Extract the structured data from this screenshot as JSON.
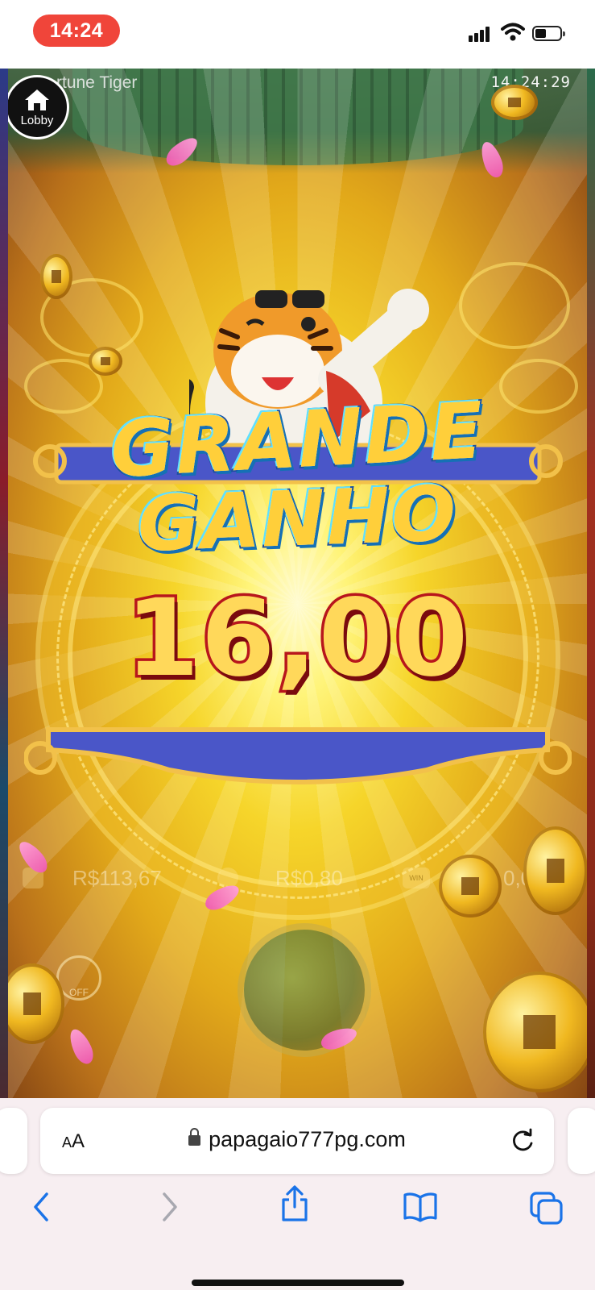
{
  "status_bar": {
    "time": "14:24",
    "signal_icon": "cellular-signal-icon",
    "wifi_icon": "wifi-icon",
    "battery_icon": "battery-icon",
    "battery_level": 0.35
  },
  "game": {
    "title": "rtune Tiger",
    "clock": "14:24:29",
    "lobby_label": "Lobby",
    "lobby_icon": "home-icon",
    "win_title_line1": "GRANDE",
    "win_title_line2": "GANHO",
    "win_amount": "16,00",
    "hud": {
      "balance": "R$113,67",
      "bet": "R$0,80",
      "win": "0,00",
      "win_badge": "WIN",
      "turbo_label": "OFF"
    }
  },
  "browser": {
    "text_size_label_small": "A",
    "text_size_label_large": "A",
    "url": "papagaio777pg.com",
    "icons": [
      "lock-icon",
      "reload-icon",
      "back-icon",
      "forward-icon",
      "share-icon",
      "bookmarks-icon",
      "tabs-icon"
    ]
  }
}
